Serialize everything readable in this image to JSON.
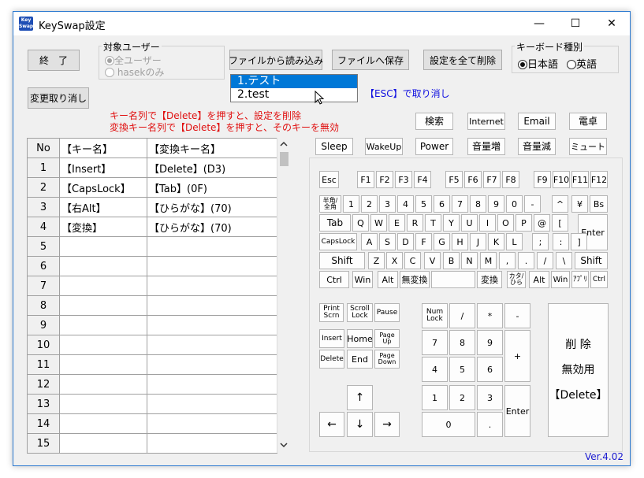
{
  "window": {
    "title": "KeySwap設定",
    "min": "—",
    "max": "☐",
    "close": "✕"
  },
  "buttons": {
    "exit": "終　了",
    "load": "ファイルから読み込み",
    "save": "ファイルへ保存",
    "delete_all": "設定を全て削除",
    "undo": "変更取り消し"
  },
  "target_user": {
    "label": "対象ユーザー",
    "all_users": "全ユーザー",
    "only_user": "hasekのみ"
  },
  "keyboard_type": {
    "label": "キーボード種別",
    "japanese": "日本語",
    "english": "英語"
  },
  "dropdown": {
    "items": [
      "1.テスト",
      "2.test"
    ]
  },
  "esc_hint": "【ESC】で取り消し",
  "instructions": {
    "line1": "キー名列で【Delete】を押すと、設定を削除",
    "line2": "変換キー名列で【Delete】を押すと、そのキーを無効"
  },
  "table": {
    "headers": [
      "No",
      "【キー名】",
      "【変換キー名】"
    ],
    "rows": [
      {
        "no": "1",
        "key": "【Insert】",
        "mapped": "【Delete】(D3)"
      },
      {
        "no": "2",
        "key": "【CapsLock】",
        "mapped": "【Tab】(0F)"
      },
      {
        "no": "3",
        "key": "【右Alt】",
        "mapped": "【ひらがな】(70)"
      },
      {
        "no": "4",
        "key": "【変換】",
        "mapped": "【ひらがな】(70)"
      },
      {
        "no": "5",
        "key": "",
        "mapped": ""
      },
      {
        "no": "6",
        "key": "",
        "mapped": ""
      },
      {
        "no": "7",
        "key": "",
        "mapped": ""
      },
      {
        "no": "8",
        "key": "",
        "mapped": ""
      },
      {
        "no": "9",
        "key": "",
        "mapped": ""
      },
      {
        "no": "10",
        "key": "",
        "mapped": ""
      },
      {
        "no": "11",
        "key": "",
        "mapped": ""
      },
      {
        "no": "12",
        "key": "",
        "mapped": ""
      },
      {
        "no": "13",
        "key": "",
        "mapped": ""
      },
      {
        "no": "14",
        "key": "",
        "mapped": ""
      },
      {
        "no": "15",
        "key": "",
        "mapped": ""
      }
    ]
  },
  "media_keys": {
    "search": "検索",
    "internet": "Internet",
    "email": "Email",
    "calc": "電卓",
    "sleep": "Sleep",
    "wakeup": "WakeUp",
    "power": "Power",
    "vol_up": "音量増",
    "vol_down": "音量減",
    "mute": "ミュート"
  },
  "keys": {
    "esc": "Esc",
    "f": [
      "F1",
      "F2",
      "F3",
      "F4",
      "F5",
      "F6",
      "F7",
      "F8",
      "F9",
      "F10",
      "F11",
      "F12"
    ],
    "num_row": [
      "1",
      "2",
      "3",
      "4",
      "5",
      "6",
      "7",
      "8",
      "9",
      "0",
      "-",
      "^",
      "¥"
    ],
    "hankaku": "半角/全角",
    "bs": "Bs",
    "tab": "Tab",
    "q_row": [
      "Q",
      "W",
      "E",
      "R",
      "T",
      "Y",
      "U",
      "I",
      "O",
      "P",
      "@",
      "["
    ],
    "enter": "Enter",
    "capslock": "CapsLock",
    "a_row": [
      "A",
      "S",
      "D",
      "F",
      "G",
      "H",
      "J",
      "K",
      "L",
      ";",
      ":",
      "]"
    ],
    "shift": "Shift",
    "z_row": [
      "Z",
      "X",
      "C",
      "V",
      "B",
      "N",
      "M",
      ",",
      ".",
      "/",
      "\\"
    ],
    "bottom": {
      "ctrl": "Ctrl",
      "win": "Win",
      "alt": "Alt",
      "muhenkan": "無変換",
      "henkan": "変換",
      "kana": "カタ/ひら",
      "app": "ｱﾌﾟﾘ"
    },
    "nav": {
      "print": "Print Scrn",
      "scroll": "Scroll Lock",
      "pause": "Pause",
      "insert": "Insert",
      "home": "Home",
      "pageup": "Page Up",
      "delete": "Delete",
      "end": "End",
      "pagedown": "Page Down",
      "up": "↑",
      "left": "←",
      "down": "↓",
      "right": "→"
    },
    "numpad": {
      "numlock": "Num Lock",
      "div": "/",
      "mul": "*",
      "sub": "-",
      "add": "+",
      "enter": "Enter",
      "n7": "7",
      "n8": "8",
      "n9": "9",
      "n4": "4",
      "n5": "5",
      "n6": "6",
      "n1": "1",
      "n2": "2",
      "n3": "3",
      "n0": "0",
      "dot": "."
    },
    "big_delete": {
      "line1": "削 除",
      "line2": "無効用",
      "line3": "【Delete】"
    }
  },
  "version": "Ver.4.02"
}
